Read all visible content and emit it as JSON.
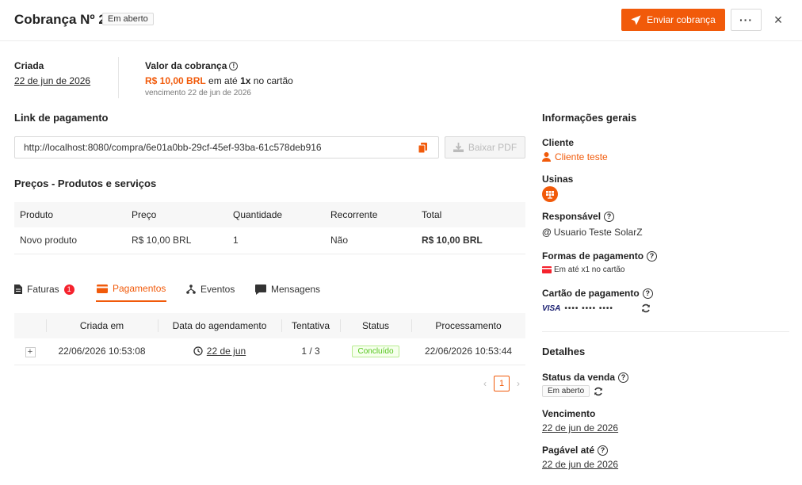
{
  "header": {
    "title": "Cobrança Nº 2",
    "status_badge": "Em aberto",
    "send_button": "Enviar cobrança",
    "more_button": "···",
    "close_icon": "×"
  },
  "summary": {
    "created_label": "Criada",
    "created_date": "22 de jun de 2026",
    "amount_label": "Valor da cobrança",
    "amount_value": "R$ 10,00 BRL",
    "amount_mid": "em até",
    "amount_installments": "1x",
    "amount_suffix": "no cartão",
    "due_text": "vencimento 22 de jun de 2026"
  },
  "payment_link": {
    "title": "Link de pagamento",
    "url": "http://localhost:8080/compra/6e01a0bb-29cf-45ef-93ba-61c578deb916",
    "download_pdf": "Baixar PDF"
  },
  "prices": {
    "title": "Preços - Produtos e serviços",
    "headers": [
      "Produto",
      "Preço",
      "Quantidade",
      "Recorrente",
      "Total"
    ],
    "rows": [
      [
        "Novo produto",
        "R$ 10,00 BRL",
        "1",
        "Não",
        "R$ 10,00 BRL"
      ]
    ]
  },
  "tabs": [
    {
      "label": "Faturas",
      "badge": "1"
    },
    {
      "label": "Pagamentos"
    },
    {
      "label": "Eventos"
    },
    {
      "label": "Mensagens"
    }
  ],
  "payments": {
    "headers": [
      "",
      "Criada em",
      "Data do agendamento",
      "Tentativa",
      "Status",
      "Processamento"
    ],
    "rows": [
      {
        "expand": "+",
        "created": "22/06/2026 10:53:08",
        "scheduled": "22 de jun",
        "attempt": "1 / 3",
        "status": "Concluído",
        "processed": "22/06/2026 10:53:44"
      }
    ],
    "pagination": {
      "prev": "‹",
      "page": "1",
      "next": "›"
    }
  },
  "general_info": {
    "title": "Informações gerais",
    "client_label": "Cliente",
    "client_value": "Cliente teste",
    "plants_label": "Usinas",
    "responsible_label": "Responsável",
    "responsible_value": "Usuario Teste SolarZ",
    "payment_methods_label": "Formas de pagamento",
    "payment_methods_value": "Em até x1 no cartão",
    "card_label": "Cartão de pagamento",
    "card_brand": "VISA",
    "card_number": "•••• •••• ••••"
  },
  "details": {
    "title": "Detalhes",
    "sale_status_label": "Status da venda",
    "sale_status_value": "Em aberto",
    "due_label": "Vencimento",
    "due_value": "22 de jun de 2026",
    "payable_label": "Pagável até",
    "payable_value": "22 de jun de 2026"
  },
  "colors": {
    "accent": "#f15a0a",
    "success": "#52c41a",
    "danger": "#f5222d"
  }
}
